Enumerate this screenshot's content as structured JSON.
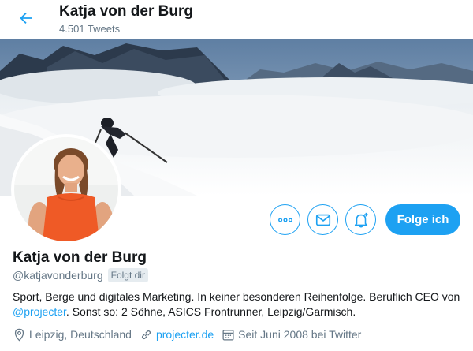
{
  "header": {
    "name": "Katja von der Burg",
    "tweet_count": "4.501 Tweets"
  },
  "actions": {
    "more_icon": "more-dots-icon",
    "message_icon": "envelope-icon",
    "notify_icon": "bell-plus-icon",
    "follow_label": "Folge ich"
  },
  "profile": {
    "name": "Katja von der Burg",
    "handle": "@katjavonderburg",
    "follows_you": "Folgt dir",
    "bio_part1": "Sport, Berge und digitales Marketing. In keiner besonderen Reihenfolge. Beruflich CEO von ",
    "bio_link": "@projecter",
    "bio_part2": ". Sonst so: 2 Söhne, ASICS Frontrunner, Leipzig/Garmisch.",
    "location": "Leipzig, Deutschland",
    "website": "projecter.de",
    "joined": "Seit Juni 2008 bei Twitter"
  },
  "colors": {
    "accent": "#1da1f2",
    "secondary_text": "#657786",
    "primary_text": "#14171a"
  }
}
